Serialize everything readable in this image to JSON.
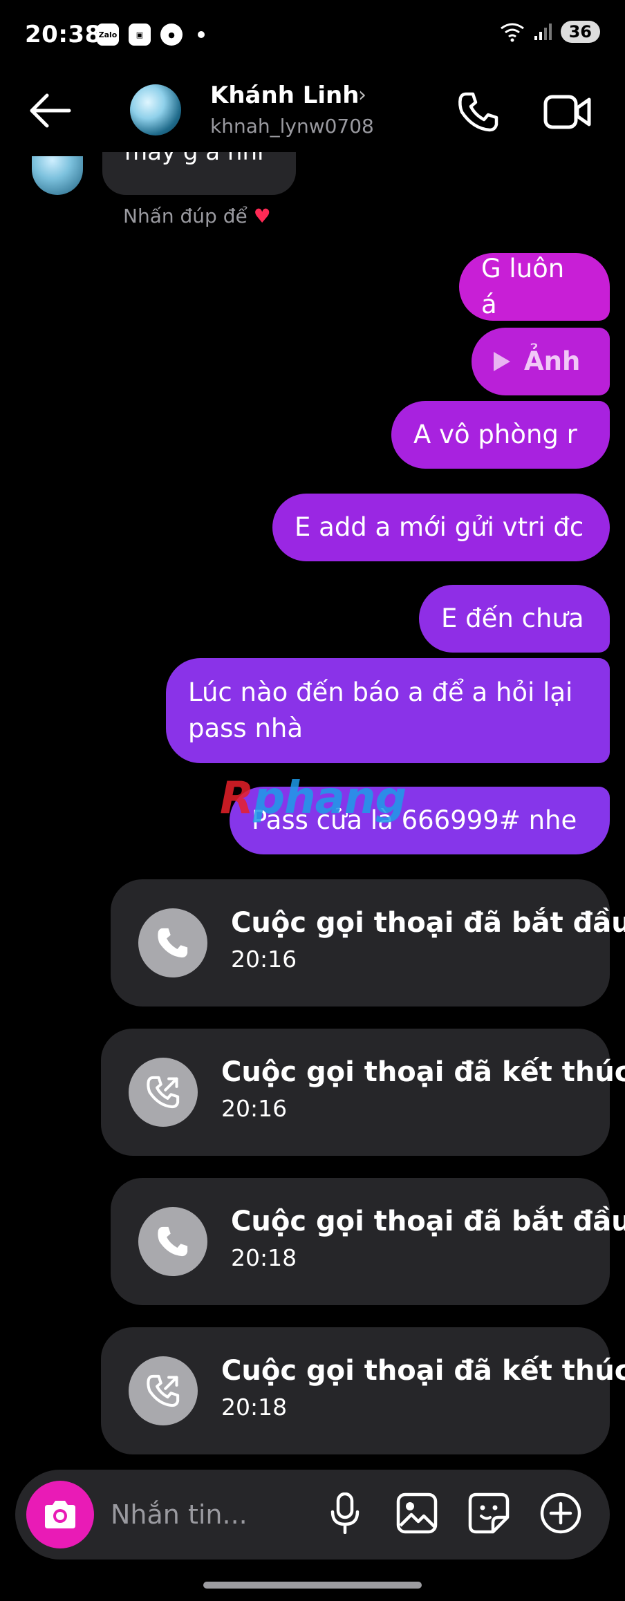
{
  "status_bar": {
    "time": "20:38",
    "app_icons": [
      "Zalo",
      "scan",
      "profile"
    ],
    "battery": "36"
  },
  "header": {
    "contact_name": "Khánh Linh",
    "username": "khnah_lynw0708"
  },
  "incoming": {
    "partial_text": "mày g ă nhỉ",
    "double_tap_hint": "Nhấn đúp để",
    "heart": "♥"
  },
  "messages": [
    {
      "text": "G luôn á"
    },
    {
      "text": "Ảnh",
      "type": "media"
    },
    {
      "text": "A vô phòng r"
    },
    {
      "text": "E add a mới gửi vtri đc"
    },
    {
      "text": "E đến chưa"
    },
    {
      "text": "Lúc nào đến báo a để a hỏi lại pass nhà"
    },
    {
      "text": "Pass cửa là 666999# nhe"
    }
  ],
  "watermark": {
    "r": "R",
    "rest": "phang"
  },
  "calls": [
    {
      "title": "Cuộc gọi thoại đã bắt đầu",
      "time": "20:16",
      "icon": "phone-icon"
    },
    {
      "title": "Cuộc gọi thoại đã kết thúc",
      "time": "20:16",
      "icon": "phone-outgoing-icon"
    },
    {
      "title": "Cuộc gọi thoại đã bắt đầu",
      "time": "20:18",
      "icon": "phone-icon"
    },
    {
      "title": "Cuộc gọi thoại đã kết thúc",
      "time": "20:18",
      "icon": "phone-outgoing-icon"
    }
  ],
  "composer": {
    "placeholder": "Nhắn tin..."
  },
  "colors": {
    "background": "#000000",
    "bubble_in": "#262629",
    "bubble_out_top": "#c81fd6",
    "bubble_out_bottom": "#8636ea",
    "camera_button": "#e91bb6"
  }
}
